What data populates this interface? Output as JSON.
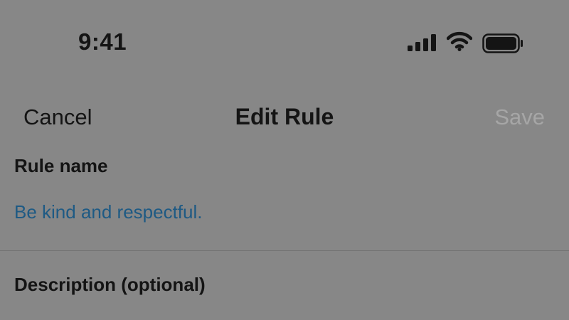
{
  "status_bar": {
    "time": "9:41",
    "signal_icon": "cellular-signal-icon",
    "wifi_icon": "wifi-icon",
    "battery_icon": "battery-icon"
  },
  "nav": {
    "cancel_label": "Cancel",
    "title": "Edit Rule",
    "save_label": "Save"
  },
  "form": {
    "rule_name_label": "Rule name",
    "rule_name_value": "Be kind and respectful.",
    "description_label": "Description (optional)"
  },
  "colors": {
    "background": "#878787",
    "text": "#141414",
    "input_text": "#1e5a84",
    "disabled_text": "#a6a6a6"
  }
}
